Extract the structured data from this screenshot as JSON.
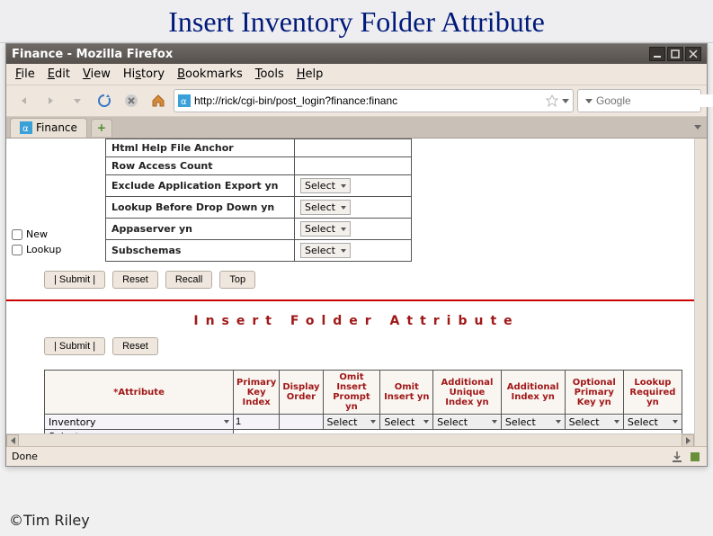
{
  "page": {
    "title": "Insert Inventory Folder Attribute",
    "footnote": "©Tim Riley"
  },
  "window": {
    "title": "Finance - Mozilla Firefox",
    "address": "http://rick/cgi-bin/post_login?finance:financ",
    "search_placeholder": "Google",
    "tab_label": "Finance",
    "status": "Done"
  },
  "menubar": {
    "file": "File",
    "edit": "Edit",
    "view": "View",
    "history": "History",
    "bookmarks": "Bookmarks",
    "tools": "Tools",
    "help": "Help"
  },
  "form": {
    "rows": [
      {
        "label": "Html Help File Anchor",
        "has_select": false
      },
      {
        "label": "Row Access Count",
        "has_select": false
      },
      {
        "label": "Exclude Application Export yn",
        "has_select": true,
        "select": "Select"
      },
      {
        "label": "Lookup Before Drop Down yn",
        "has_select": true,
        "select": "Select"
      },
      {
        "label": "Appaserver yn",
        "has_select": true,
        "select": "Select"
      },
      {
        "label": "Subschemas",
        "has_select": true,
        "select": "Select"
      }
    ],
    "side": {
      "new": "New",
      "lookup": "Lookup"
    },
    "buttons": {
      "submit": "|   Submit   |",
      "reset": "Reset",
      "recall": "Recall",
      "top": "Top"
    }
  },
  "section": {
    "heading": "Insert   Folder   Attribute",
    "buttons": {
      "submit": "|   Submit   |",
      "reset": "Reset"
    }
  },
  "fa": {
    "headers": {
      "attr": "*Attribute",
      "pki": "Primary Key Index",
      "disp": "Display Order",
      "omit_ins_prompt": "Omit Insert Prompt yn",
      "omit_ins": "Omit Insert yn",
      "add_uniq": "Additional Unique Index yn",
      "add_idx": "Additional Index yn",
      "opt_pk": "Optional Primary Key yn",
      "lookup_req": "Lookup Required yn"
    },
    "row": {
      "attr": "Inventory",
      "pki": "1",
      "select": "Select"
    }
  },
  "chart_data": null
}
